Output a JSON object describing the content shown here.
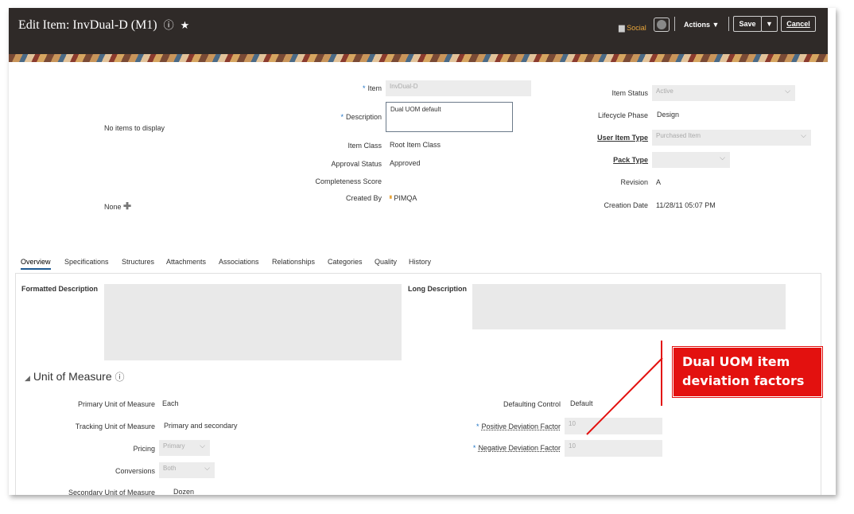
{
  "header": {
    "title": "Edit Item: InvDual-D (M1)",
    "help_icon": "?",
    "star_icon": "★",
    "social": "Social",
    "actions": "Actions ▼",
    "save": "Save",
    "save_dropdown": "▼",
    "cancel": "Cancel"
  },
  "left": {
    "no_items": "No items to display",
    "none": "None"
  },
  "item_fields": {
    "item_label": "Item",
    "item_value": "InvDual-D",
    "description_label": "Description",
    "description_value": "Dual UOM default",
    "item_class_label": "Item Class",
    "item_class_value": "Root Item Class",
    "approval_status_label": "Approval Status",
    "approval_status_value": "Approved",
    "completeness_label": "Completeness Score",
    "created_by_label": "Created By",
    "created_by_value": "PIMQA"
  },
  "right_fields": {
    "item_status_label": "Item Status",
    "item_status_value": "Active",
    "lifecycle_label": "Lifecycle Phase",
    "lifecycle_value": "Design",
    "user_item_type_label": "User Item Type",
    "user_item_type_value": "Purchased Item",
    "pack_type_label": "Pack Type",
    "revision_label": "Revision",
    "revision_value": "A",
    "creation_date_label": "Creation Date",
    "creation_date_value": "11/28/11 05:07 PM"
  },
  "tabs": [
    "Overview",
    "Specifications",
    "Structures",
    "Attachments",
    "Associations",
    "Relationships",
    "Categories",
    "Quality",
    "History"
  ],
  "overview": {
    "formatted_description": "Formatted Description",
    "long_description": "Long Description"
  },
  "uom": {
    "section_title": "Unit of Measure",
    "primary_label": "Primary Unit of Measure",
    "primary_value": "Each",
    "tracking_label": "Tracking Unit of Measure",
    "tracking_value": "Primary and secondary",
    "pricing_label": "Pricing",
    "pricing_value": "Primary",
    "conversions_label": "Conversions",
    "conversions_value": "Both",
    "secondary_label": "Secondary Unit of Measure",
    "secondary_value": "Dozen",
    "defaulting_label": "Defaulting Control",
    "defaulting_value": "Default",
    "positive_label": "Positive Deviation Factor",
    "positive_value": "10",
    "negative_label": "Negative Deviation Factor",
    "negative_value": "10"
  },
  "callout": {
    "line1": "Dual UOM item",
    "line2": "deviation factors",
    "color": "#e3110f"
  }
}
